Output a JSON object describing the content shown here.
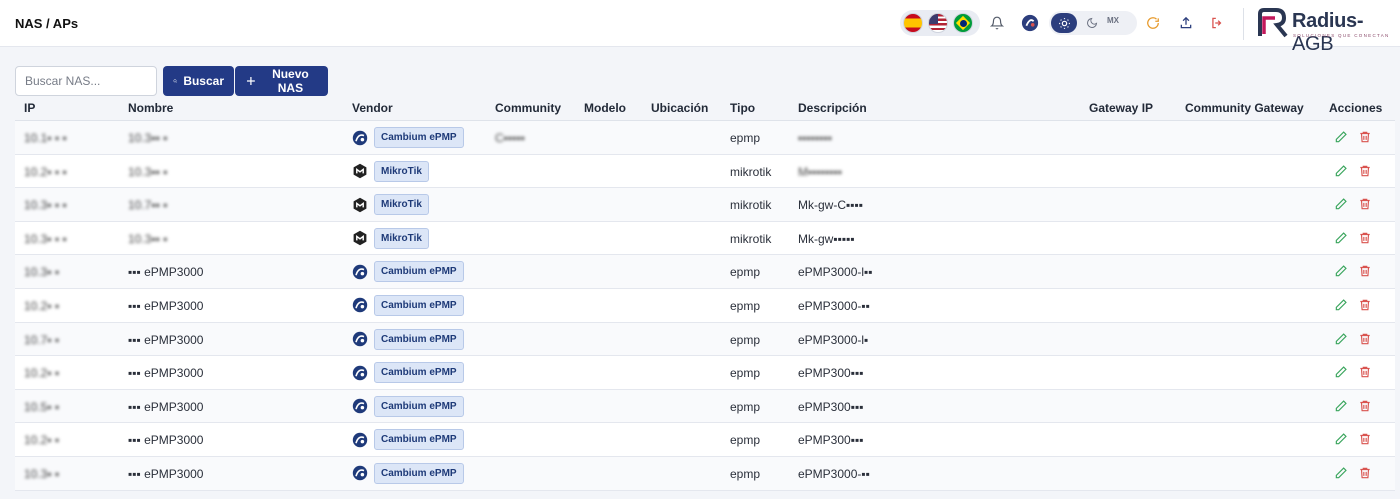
{
  "header": {
    "title": "NAS / APs",
    "theme_mx_label": "MX",
    "logo_text": "Radius-",
    "logo_text_suffix": "AGB",
    "logo_subtitle": "SOLUCIONES QUE CONECTAN",
    "icons": [
      "flag-es",
      "flag-us",
      "flag-br",
      "bell-icon",
      "cambium-icon",
      "sun-icon",
      "moon-icon",
      "refresh-icon",
      "upload-icon",
      "logout-icon"
    ]
  },
  "toolbar": {
    "search_placeholder": "Buscar NAS...",
    "search_value": "",
    "search_button": "Buscar",
    "new_button": "Nuevo NAS"
  },
  "table": {
    "columns": [
      "IP",
      "Nombre",
      "Vendor",
      "Community",
      "Modelo",
      "Ubicación",
      "Tipo",
      "Descripción",
      "Gateway IP",
      "Community Gateway",
      "Acciones"
    ],
    "rows": [
      {
        "ip": "10.1▪ ▪ ▪",
        "name": "10.3▪▪ ▪",
        "vendor": "Cambium ePMP",
        "vendor_icon": "cambium-icon",
        "community": "C▪▪▪▪▪",
        "tipo": "epmp",
        "desc": "▪▪▪▪▪▪▪▪"
      },
      {
        "ip": "10.2▪ ▪ ▪",
        "name": "10.3▪▪ ▪",
        "vendor": "MikroTik",
        "vendor_icon": "mikrotik-icon",
        "community": "",
        "tipo": "mikrotik",
        "desc": "M▪▪▪▪▪▪▪▪"
      },
      {
        "ip": "10.3▪ ▪ ▪",
        "name": "10.7▪▪ ▪",
        "vendor": "MikroTik",
        "vendor_icon": "mikrotik-icon",
        "community": "",
        "tipo": "mikrotik",
        "desc": "Mk-gw-C▪▪▪▪"
      },
      {
        "ip": "10.3▪ ▪ ▪",
        "name": "10.3▪▪ ▪",
        "vendor": "MikroTik",
        "vendor_icon": "mikrotik-icon",
        "community": "",
        "tipo": "mikrotik",
        "desc": "Mk-gw▪▪▪▪▪"
      },
      {
        "ip": "10.3▪ ▪",
        "name": "▪▪▪ ePMP3000",
        "vendor": "Cambium ePMP",
        "vendor_icon": "cambium-icon",
        "community": "",
        "tipo": "epmp",
        "desc": "ePMP3000-l▪▪"
      },
      {
        "ip": "10.2▪ ▪",
        "name": "▪▪▪ ePMP3000",
        "vendor": "Cambium ePMP",
        "vendor_icon": "cambium-icon",
        "community": "",
        "tipo": "epmp",
        "desc": "ePMP3000-▪▪"
      },
      {
        "ip": "10.7▪ ▪",
        "name": "▪▪▪ ePMP3000",
        "vendor": "Cambium ePMP",
        "vendor_icon": "cambium-icon",
        "community": "",
        "tipo": "epmp",
        "desc": "ePMP3000-l▪"
      },
      {
        "ip": "10.2▪ ▪",
        "name": "▪▪▪ ePMP3000",
        "vendor": "Cambium ePMP",
        "vendor_icon": "cambium-icon",
        "community": "",
        "tipo": "epmp",
        "desc": "ePMP300▪▪▪"
      },
      {
        "ip": "10.5▪ ▪",
        "name": "▪▪▪ ePMP3000",
        "vendor": "Cambium ePMP",
        "vendor_icon": "cambium-icon",
        "community": "",
        "tipo": "epmp",
        "desc": "ePMP300▪▪▪"
      },
      {
        "ip": "10.2▪ ▪",
        "name": "▪▪▪ ePMP3000",
        "vendor": "Cambium ePMP",
        "vendor_icon": "cambium-icon",
        "community": "",
        "tipo": "epmp",
        "desc": "ePMP300▪▪▪"
      },
      {
        "ip": "10.3▪ ▪",
        "name": "▪▪▪ ePMP3000",
        "vendor": "Cambium ePMP",
        "vendor_icon": "cambium-icon",
        "community": "",
        "tipo": "epmp",
        "desc": "ePMP3000-▪▪"
      }
    ],
    "action_icons": [
      "edit-icon",
      "delete-icon"
    ]
  },
  "colors": {
    "primary": "#233a86",
    "edit": "#3aa55d",
    "delete": "#d9534f",
    "badge_bg": "#dce6f7"
  }
}
